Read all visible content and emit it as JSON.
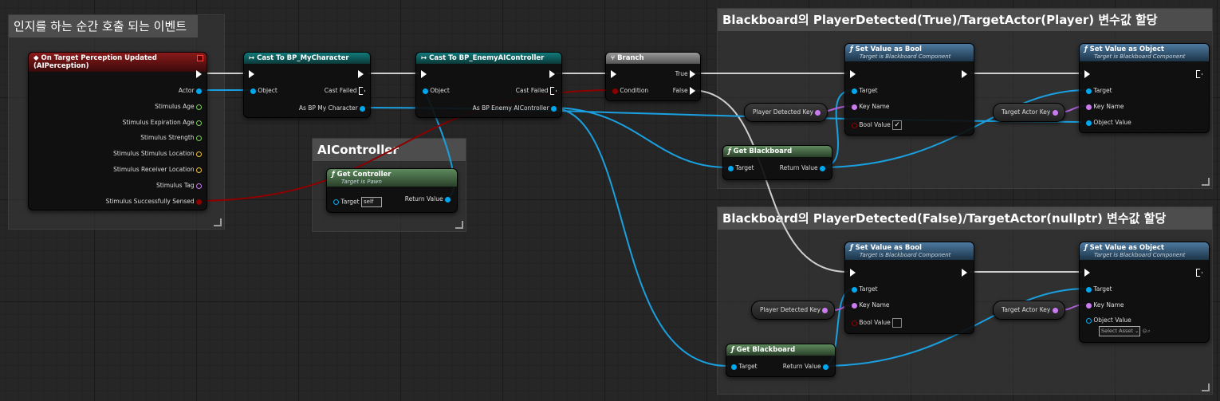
{
  "comments": {
    "perception": "인지를 하는 순간 호출 되는 이벤트",
    "aicontroller": "AIController",
    "bb_true": "Blackboard의 PlayerDetected(True)/TargetActor(Player) 변수값 할당",
    "bb_false": "Blackboard의 PlayerDetected(False)/TargetActor(nullptr) 변수값 할당"
  },
  "event_node": {
    "title": "On Target Perception Updated (AIPerception)",
    "pins": [
      "Actor",
      "Stimulus Age",
      "Stimulus Expiration Age",
      "Stimulus Strength",
      "Stimulus Stimulus Location",
      "Stimulus Receiver Location",
      "Stimulus Tag",
      "Stimulus Successfully Sensed"
    ]
  },
  "cast_character": {
    "title": "Cast To BP_MyCharacter",
    "object": "Object",
    "failed": "Cast Failed",
    "out": "As BP My Character"
  },
  "cast_controller": {
    "title": "Cast To BP_EnemyAIController",
    "object": "Object",
    "failed": "Cast Failed",
    "out": "As BP Enemy AIController"
  },
  "get_controller": {
    "title": "Get Controller",
    "subtitle": "Target is Pawn",
    "target": "Target",
    "self": "self",
    "ret": "Return Value"
  },
  "branch": {
    "title": "Branch",
    "condition": "Condition",
    "true": "True",
    "false": "False"
  },
  "set_bool": {
    "title": "Set Value as Bool",
    "subtitle": "Target is Blackboard Component",
    "target": "Target",
    "key": "Key Name",
    "value": "Bool Value"
  },
  "set_object": {
    "title": "Set Value as Object",
    "subtitle": "Target is Blackboard Component",
    "target": "Target",
    "key": "Key Name",
    "value": "Object Value",
    "select": "Select Asset"
  },
  "get_blackboard": {
    "title": "Get Blackboard",
    "target": "Target",
    "ret": "Return Value"
  },
  "vars": {
    "player_detected": "Player Detected Key",
    "target_actor": "Target Actor Key"
  },
  "colors": {
    "exec": "#ffffff",
    "object": "#00a8f0",
    "bool": "#8c0000",
    "name": "#c87cf0",
    "float": "#7ed05a",
    "vector": "#f2c030",
    "tag": "#c87cf0"
  }
}
